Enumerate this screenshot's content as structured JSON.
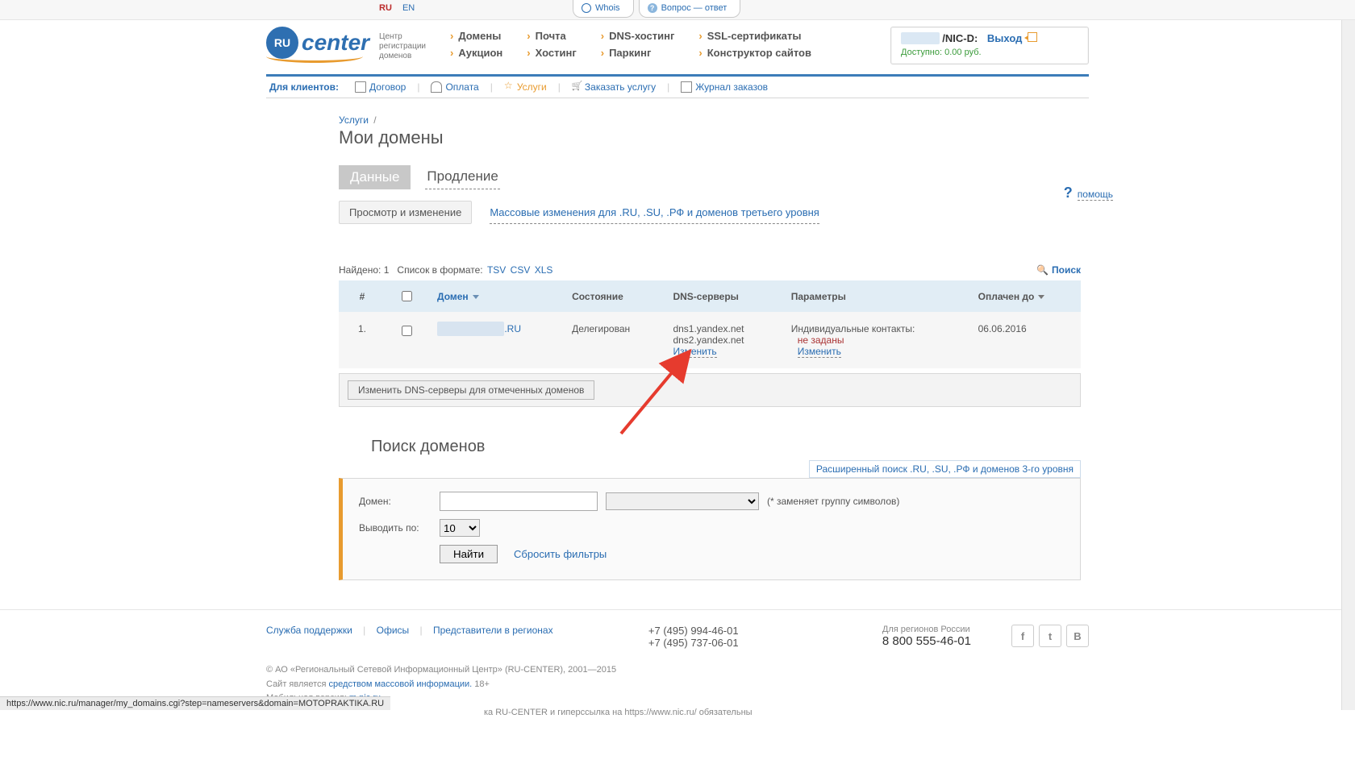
{
  "lang": {
    "ru": "RU",
    "en": "EN"
  },
  "top_tabs": {
    "whois": "Whois",
    "qa": "Вопрос — ответ"
  },
  "logo": {
    "brand": "center",
    "badge": "RU",
    "sub1": "Центр",
    "sub2": "регистрации",
    "sub3": "доменов"
  },
  "mainnav": {
    "col1a": "Домены",
    "col1b": "Аукцион",
    "col2a": "Почта",
    "col2b": "Хостинг",
    "col3a": "DNS-хостинг",
    "col3b": "Паркинг",
    "col4a": "SSL-сертификаты",
    "col4b": "Конструктор сайтов"
  },
  "userbox": {
    "suffix": "/NIC-D:",
    "logout": "Выход",
    "balance_lbl": "Доступно:",
    "balance_val": "0.00 руб."
  },
  "clientbar": {
    "label": "Для клиентов:",
    "contract": "Договор",
    "payment": "Оплата",
    "services": "Услуги",
    "order": "Заказать услугу",
    "journal": "Журнал заказов"
  },
  "breadcrumb": {
    "services": "Услуги",
    "sep": "/"
  },
  "page_title": "Мои домены",
  "tabs": {
    "data": "Данные",
    "renewal": "Продление"
  },
  "subtabs": {
    "view_edit": "Просмотр и изменение",
    "mass": "Массовые изменения для .RU, .SU, .РФ и доменов третьего уровня"
  },
  "help": "помощь",
  "listmeta": {
    "found_lbl": "Найдено:",
    "found_val": "1",
    "format_lbl": "Список в формате:",
    "tsv": "TSV",
    "csv": "CSV",
    "xls": "XLS",
    "search": "Поиск"
  },
  "table": {
    "th_num": "#",
    "th_domain": "Домен",
    "th_state": "Состояние",
    "th_dns": "DNS-серверы",
    "th_params": "Параметры",
    "th_paid": "Оплачен до",
    "row1": {
      "num": "1.",
      "domain_suffix": ".RU",
      "state": "Делегирован",
      "dns1": "dns1.yandex.net",
      "dns2": "dns2.yandex.net",
      "change": "Изменить",
      "param_lbl": "Индивидуальные контакты:",
      "param_val": "не заданы",
      "param_change": "Изменить",
      "paid": "06.06.2016"
    }
  },
  "bulk_btn": "Изменить DNS-серверы для отмеченных доменов",
  "search_section": {
    "title": "Поиск доменов",
    "adv": "Расширенный поиск .RU, .SU, .РФ и доменов 3-го уровня",
    "domain_lbl": "Домен:",
    "hint": "(* заменяет группу символов)",
    "perpage_lbl": "Выводить по:",
    "perpage_val": "10",
    "find": "Найти",
    "reset": "Сбросить фильтры"
  },
  "footer": {
    "support": "Служба поддержки",
    "offices": "Офисы",
    "reps": "Представители в регионах",
    "phone1": "+7 (495) 994-46-01",
    "phone2": "+7 (495) 737-06-01",
    "reg_lbl": "Для регионов России",
    "reg_phone": "8 800 555-46-01",
    "social_f": "f",
    "social_t": "t",
    "social_v": "B"
  },
  "legal": {
    "l1": "© АО «Региональный Сетевой Информационный Центр» (RU-CENTER), 2001—2015",
    "l2a": "Сайт является ",
    "l2b": "средством массовой информации.",
    "l2c": " 18+",
    "l3a": "Мобильная версия: ",
    "l3b": "m.nic.ru",
    "l4": "ка RU-CENTER и гиперссылка на https://www.nic.ru/ обязательны"
  },
  "statusbar": "https://www.nic.ru/manager/my_domains.cgi?step=nameservers&domain=MOTOPRAKTIKA.RU"
}
